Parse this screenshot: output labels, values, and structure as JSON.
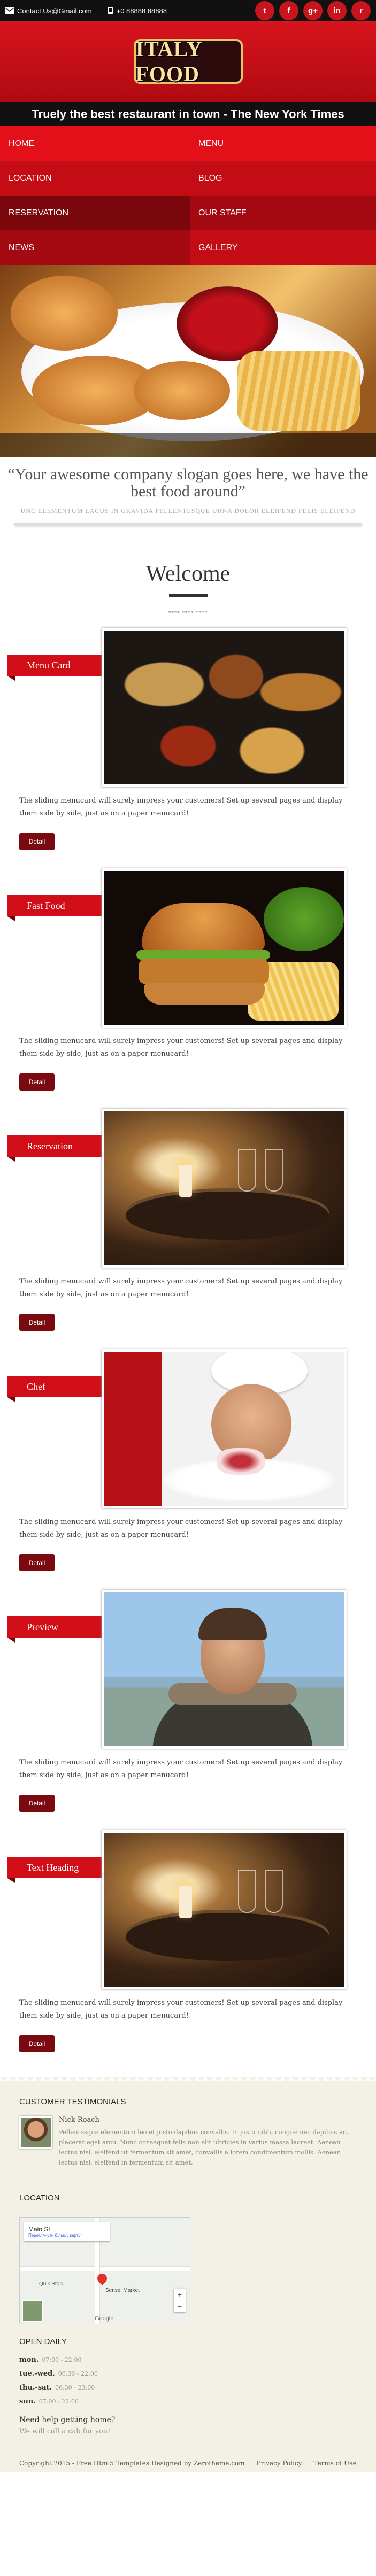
{
  "topbar": {
    "email": "Contact.Us@Gmail.com",
    "phone": "+0 88888 88888",
    "social": [
      {
        "icon": "twitter-icon",
        "glyph": "t"
      },
      {
        "icon": "facebook-icon",
        "glyph": "f"
      },
      {
        "icon": "google-plus-icon",
        "glyph": "g+"
      },
      {
        "icon": "linkedin-icon",
        "glyph": "in"
      },
      {
        "icon": "rss-icon",
        "glyph": "r"
      }
    ]
  },
  "header": {
    "logo": "ITALY FOOD",
    "tagline": "Truely the best restaurant in town - The New York Times"
  },
  "nav": {
    "home": "HOME",
    "menu": "MENU",
    "location": "LOCATION",
    "blog": "BLOG",
    "reservation": "RESERVATION",
    "our_staff": "OUR STAFF",
    "news": "NEWS",
    "gallery": "GALLERY"
  },
  "slogan": {
    "title": "“Your awesome company slogan goes here, we have the best food around”",
    "subtitle": "UNC ELEMENTUM LACUS IN GRAVIDA PELLENTESQUE URNA DOLOR ELEIFEND FELIS ELEIFEND"
  },
  "welcome": {
    "title": "Welcome",
    "small": "**** **** ****"
  },
  "cards": [
    {
      "label": "Menu Card",
      "text": "The sliding menucard will surely impress your customers! Set up several pages and display them side by side, just as on a paper menucard!",
      "button": "Detail"
    },
    {
      "label": "Fast Food",
      "text": "The sliding menucard will surely impress your customers! Set up several pages and display them side by side, just as on a paper menucard!",
      "button": "Detail"
    },
    {
      "label": "Reservation",
      "text": "The sliding menucard will surely impress your customers! Set up several pages and display them side by side, just as on a paper menucard!",
      "button": "Detail"
    },
    {
      "label": "Chef",
      "text": "The sliding menucard will surely impress your customers! Set up several pages and display them side by side, just as on a paper menucard!",
      "button": "Detail"
    },
    {
      "label": "Preview",
      "text": "The sliding menucard will surely impress your customers! Set up several pages and display them side by side, just as on a paper menucard!",
      "button": "Detail"
    },
    {
      "label": "Text Heading",
      "text": "The sliding menucard will surely impress your customers! Set up several pages and display them side by side, just as on a paper menucard!",
      "button": "Detail"
    }
  ],
  "footer": {
    "testimonials_title": "CUSTOMER TESTIMONIALS",
    "testimonial_name": "Nick Roach",
    "testimonial_text": "Pellentesque elementum leo et justo dapibus convallis. In justo nibh, congue nec dapibus ac, placerat eget arcu. Nunc consequat felis non elit ultricies in varius massa laoreet. Aenean lectus nisl, eleifend ut fermentum sit amet, convallis a lorem condimentum mollis. Aenean lectus nisl, eleifend in fermentum sit amet.",
    "location_title": "LOCATION",
    "map": {
      "place": "Main St",
      "link": "Переглянути більшу карту",
      "poi1": "Sensei Market",
      "poi2": "Quik Stop",
      "brand": "Google"
    },
    "open_title": "OPEN DAILY",
    "hours": [
      {
        "day": "mon.",
        "time": "07:00 - 22:00"
      },
      {
        "day": "tue.-wed.",
        "time": "06:30 - 22:00"
      },
      {
        "day": "thu.-sat.",
        "time": "06:30 - 23:00"
      },
      {
        "day": "sun.",
        "time": "07:00 - 22:00"
      }
    ],
    "help": "Need help getting home?",
    "help_sub": "We will call a cab for you!",
    "copyright": "Copyright 2015 - Free Html5 Templates Designed by Zerotheme.com",
    "privacy": "Privacy Policy",
    "terms": "Terms of Use"
  }
}
